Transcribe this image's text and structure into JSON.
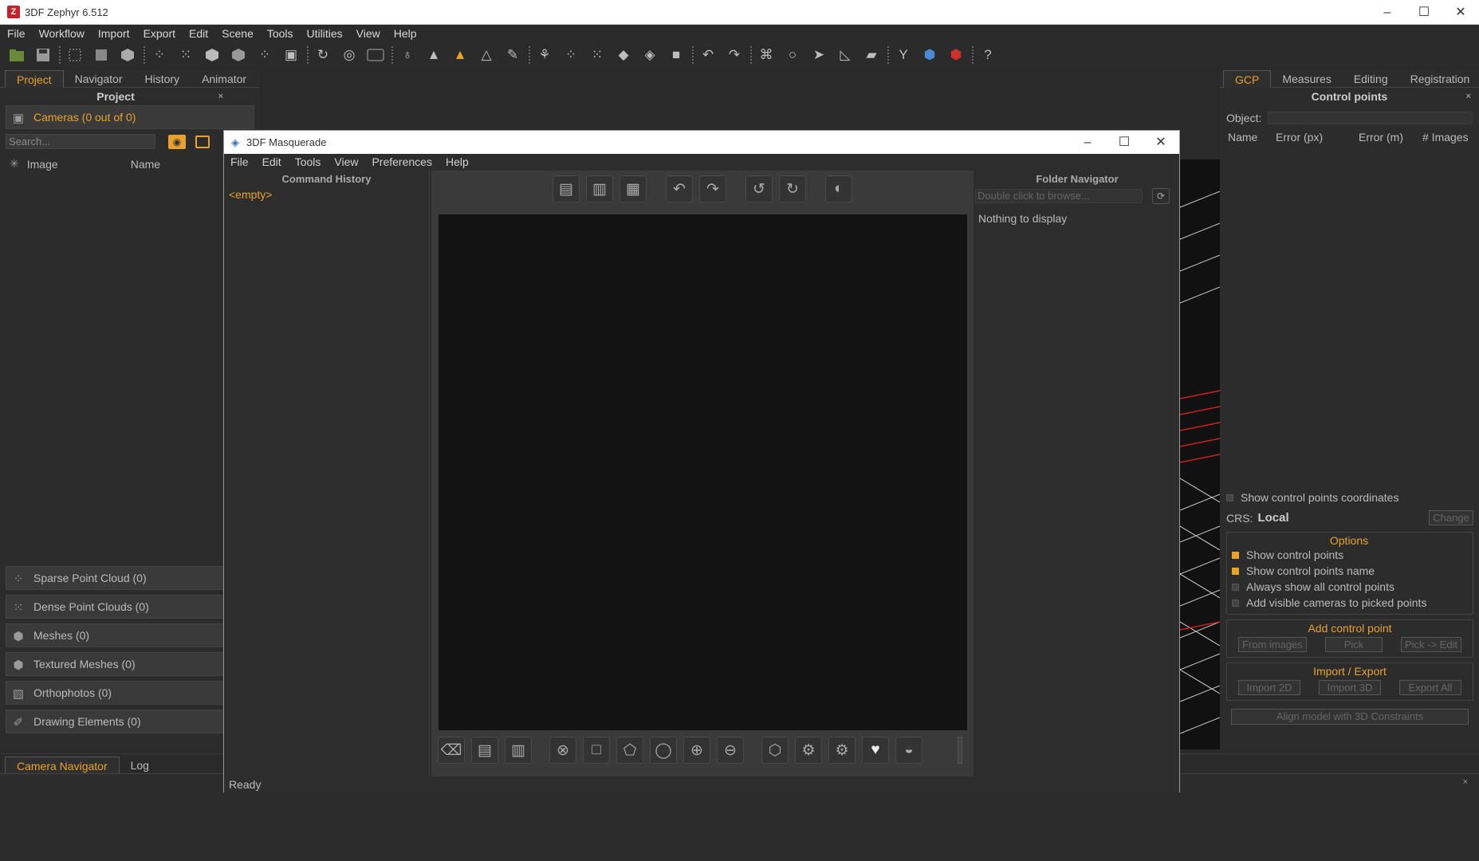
{
  "window": {
    "title": "3DF Zephyr 6.512",
    "controls": {
      "minimize": "–",
      "maximize": "☐",
      "close": "✕"
    }
  },
  "menubar": [
    "File",
    "Workflow",
    "Import",
    "Export",
    "Edit",
    "Scene",
    "Tools",
    "Utilities",
    "View",
    "Help"
  ],
  "toolbar": {
    "icons": [
      "open-folder-icon",
      "save-icon",
      "crop-icon",
      "box-icon",
      "box-filled-icon",
      "sparse-icon",
      "dense-icon",
      "mesh-icon",
      "textured-mesh-icon",
      "pointcloud-icon",
      "camera-icon",
      "rotate-icon",
      "orbit-icon",
      "wasd-icon",
      "light-icon",
      "measure-icon",
      "triangle-warning-icon",
      "triangle-outline-icon",
      "brush-icon",
      "filter-icon",
      "dots-icon",
      "dots-dense-icon",
      "cube-icon",
      "cube-outline-icon",
      "square-icon",
      "undo-icon",
      "redo-icon",
      "select-icon",
      "lasso-icon",
      "pointer-icon",
      "ruler-icon",
      "plane-icon",
      "wrench-icon",
      "zephyr-blue-icon",
      "zephyr-red-icon",
      "help-icon"
    ],
    "help_glyph": "?"
  },
  "left_panel": {
    "tabs": [
      "Project",
      "Navigator",
      "History",
      "Animator"
    ],
    "active_tab": "Project",
    "title": "Project",
    "close": "×",
    "cameras": "Cameras (0 out of 0)",
    "search_placeholder": "Search...",
    "columns": {
      "image": "Image",
      "name": "Name"
    },
    "sections": [
      {
        "label": "Sparse Point Cloud (0)",
        "icon": "sparse-cloud-icon"
      },
      {
        "label": "Dense Point Clouds (0)",
        "icon": "dense-cloud-icon"
      },
      {
        "label": "Meshes (0)",
        "icon": "mesh-icon"
      },
      {
        "label": "Textured Meshes (0)",
        "icon": "textured-mesh-icon"
      },
      {
        "label": "Orthophotos (0)",
        "icon": "orthophoto-icon"
      },
      {
        "label": "Drawing Elements (0)",
        "icon": "drawing-icon"
      }
    ]
  },
  "bottom_panel": {
    "tabs": [
      "Camera Navigator",
      "Log"
    ],
    "active_tab": "Camera Navigator",
    "close": "×"
  },
  "right_panel": {
    "tabs": [
      "GCP",
      "Measures",
      "Editing",
      "Registration"
    ],
    "active_tab": "GCP",
    "title": "Control points",
    "close": "×",
    "object_label": "Object:",
    "columns": [
      "Name",
      "Error (px)",
      "Error (m)",
      "# Images"
    ],
    "show_coords": "Show control points coordinates",
    "crs_label": "CRS:",
    "crs_value": "Local",
    "change_button": "Change",
    "options_title": "Options",
    "options": [
      {
        "label": "Show control points",
        "checked": true
      },
      {
        "label": "Show control points name",
        "checked": true
      },
      {
        "label": "Always show all control points",
        "checked": false
      },
      {
        "label": "Add visible cameras to picked points",
        "checked": false
      }
    ],
    "add_title": "Add control point",
    "add_buttons": [
      "From images",
      "Pick",
      "Pick -> Edit"
    ],
    "io_title": "Import / Export",
    "io_buttons": [
      "Import 2D",
      "Import 3D",
      "Export All"
    ],
    "align_button": "Align model with 3D Constraints"
  },
  "masquerade": {
    "title": "3DF Masquerade",
    "menu": [
      "File",
      "Edit",
      "Tools",
      "View",
      "Preferences",
      "Help"
    ],
    "command_history_title": "Command History",
    "command_history_empty": "<empty>",
    "folder_navigator_title": "Folder Navigator",
    "folder_placeholder": "Double click to browse...",
    "folder_empty": "Nothing to display",
    "status": "Ready",
    "accent": "#e8a22b"
  },
  "colors": {
    "accent": "#e8a22b",
    "panel": "#2c2c2c",
    "canvas": "#131313"
  }
}
